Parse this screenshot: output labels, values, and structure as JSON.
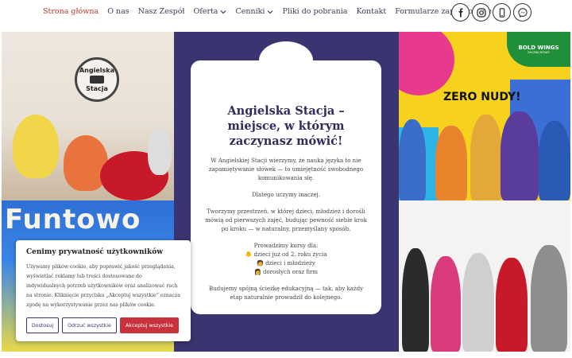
{
  "nav": {
    "items": [
      {
        "label": "Strona główna",
        "active": true,
        "dropdown": false
      },
      {
        "label": "O nas",
        "active": false,
        "dropdown": false
      },
      {
        "label": "Nasz Zespół",
        "active": false,
        "dropdown": false
      },
      {
        "label": "Oferta",
        "active": false,
        "dropdown": true
      },
      {
        "label": "Cenniki",
        "active": false,
        "dropdown": true
      },
      {
        "label": "Pliki do pobrania",
        "active": false,
        "dropdown": false
      },
      {
        "label": "Kontakt",
        "active": false,
        "dropdown": false
      },
      {
        "label": "Formularze zapisu online",
        "active": false,
        "dropdown": true
      }
    ],
    "social": [
      "facebook-icon",
      "instagram-icon",
      "phone-icon",
      "messenger-icon"
    ],
    "active_color": "#c0392b"
  },
  "hero": {
    "photo_logo": [
      "Angielska",
      "Stacja"
    ],
    "photo_banner": "Funtowo",
    "panel_color": "#3a3470",
    "title": "Angielska Stacja – miejsce, w którym zaczynasz mówić!",
    "para1": "W Angielskiej Stacji wierzymy, że nauka języka to nie zapamiętywanie słówek — to umiejętność swobodnego komunikowania się.",
    "para2": "Dlatego uczymy inaczej.",
    "para3": "Tworzymy przestrzeń, w której dzieci, młodzież i dorośli mówią od pierwszych zajęć, budując pewność siebie krok po kroku — w naturalny, przemyślany sposób.",
    "courses_intro": "Prowadzimy kursy dla:",
    "courses": [
      "🐥 dzieci już od 2. roku życia",
      "🧑 dzieci i młodzieży",
      "👩 dorosłych oraz firm"
    ],
    "para4": "Budujemy spójną ścieżkę edukacyjną — tak, aby każdy etap naturalnie prowadził do kolejnego.",
    "right_logo": "BOLD WINGS",
    "right_logo_sub": "ZACZNIJ MÓWIĆ",
    "right_banner": "ZERO NUDY!"
  },
  "cookie": {
    "title": "Cenimy prywatność użytkowników",
    "text": "Używamy plików cookie, aby poprawić jakość przeglądania, wyświetlać reklamy lub treści dostosowane do indywidualnych potrzeb użytkowników oraz analizować ruch na stronie. Kliknięcie przycisku „Akceptuj wszystkie” oznacza zgodę na wykorzystywanie przez nas plików cookie.",
    "btn_customize": "Dostosuj",
    "btn_reject": "Odrzuć wszystkie",
    "btn_accept": "Akceptuj wszystkie",
    "accent": "#c7323d"
  }
}
